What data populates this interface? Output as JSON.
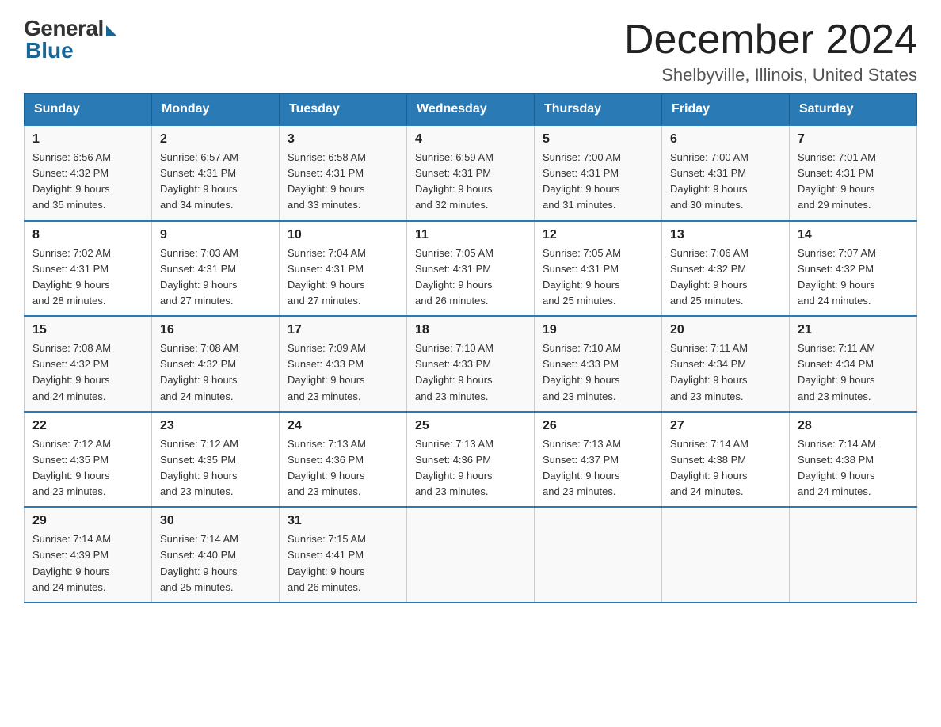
{
  "logo": {
    "general": "General",
    "blue": "Blue"
  },
  "title": {
    "month": "December 2024",
    "location": "Shelbyville, Illinois, United States"
  },
  "weekdays": [
    "Sunday",
    "Monday",
    "Tuesday",
    "Wednesday",
    "Thursday",
    "Friday",
    "Saturday"
  ],
  "weeks": [
    [
      {
        "day": "1",
        "sunrise": "6:56 AM",
        "sunset": "4:32 PM",
        "daylight": "9 hours and 35 minutes."
      },
      {
        "day": "2",
        "sunrise": "6:57 AM",
        "sunset": "4:31 PM",
        "daylight": "9 hours and 34 minutes."
      },
      {
        "day": "3",
        "sunrise": "6:58 AM",
        "sunset": "4:31 PM",
        "daylight": "9 hours and 33 minutes."
      },
      {
        "day": "4",
        "sunrise": "6:59 AM",
        "sunset": "4:31 PM",
        "daylight": "9 hours and 32 minutes."
      },
      {
        "day": "5",
        "sunrise": "7:00 AM",
        "sunset": "4:31 PM",
        "daylight": "9 hours and 31 minutes."
      },
      {
        "day": "6",
        "sunrise": "7:00 AM",
        "sunset": "4:31 PM",
        "daylight": "9 hours and 30 minutes."
      },
      {
        "day": "7",
        "sunrise": "7:01 AM",
        "sunset": "4:31 PM",
        "daylight": "9 hours and 29 minutes."
      }
    ],
    [
      {
        "day": "8",
        "sunrise": "7:02 AM",
        "sunset": "4:31 PM",
        "daylight": "9 hours and 28 minutes."
      },
      {
        "day": "9",
        "sunrise": "7:03 AM",
        "sunset": "4:31 PM",
        "daylight": "9 hours and 27 minutes."
      },
      {
        "day": "10",
        "sunrise": "7:04 AM",
        "sunset": "4:31 PM",
        "daylight": "9 hours and 27 minutes."
      },
      {
        "day": "11",
        "sunrise": "7:05 AM",
        "sunset": "4:31 PM",
        "daylight": "9 hours and 26 minutes."
      },
      {
        "day": "12",
        "sunrise": "7:05 AM",
        "sunset": "4:31 PM",
        "daylight": "9 hours and 25 minutes."
      },
      {
        "day": "13",
        "sunrise": "7:06 AM",
        "sunset": "4:32 PM",
        "daylight": "9 hours and 25 minutes."
      },
      {
        "day": "14",
        "sunrise": "7:07 AM",
        "sunset": "4:32 PM",
        "daylight": "9 hours and 24 minutes."
      }
    ],
    [
      {
        "day": "15",
        "sunrise": "7:08 AM",
        "sunset": "4:32 PM",
        "daylight": "9 hours and 24 minutes."
      },
      {
        "day": "16",
        "sunrise": "7:08 AM",
        "sunset": "4:32 PM",
        "daylight": "9 hours and 24 minutes."
      },
      {
        "day": "17",
        "sunrise": "7:09 AM",
        "sunset": "4:33 PM",
        "daylight": "9 hours and 23 minutes."
      },
      {
        "day": "18",
        "sunrise": "7:10 AM",
        "sunset": "4:33 PM",
        "daylight": "9 hours and 23 minutes."
      },
      {
        "day": "19",
        "sunrise": "7:10 AM",
        "sunset": "4:33 PM",
        "daylight": "9 hours and 23 minutes."
      },
      {
        "day": "20",
        "sunrise": "7:11 AM",
        "sunset": "4:34 PM",
        "daylight": "9 hours and 23 minutes."
      },
      {
        "day": "21",
        "sunrise": "7:11 AM",
        "sunset": "4:34 PM",
        "daylight": "9 hours and 23 minutes."
      }
    ],
    [
      {
        "day": "22",
        "sunrise": "7:12 AM",
        "sunset": "4:35 PM",
        "daylight": "9 hours and 23 minutes."
      },
      {
        "day": "23",
        "sunrise": "7:12 AM",
        "sunset": "4:35 PM",
        "daylight": "9 hours and 23 minutes."
      },
      {
        "day": "24",
        "sunrise": "7:13 AM",
        "sunset": "4:36 PM",
        "daylight": "9 hours and 23 minutes."
      },
      {
        "day": "25",
        "sunrise": "7:13 AM",
        "sunset": "4:36 PM",
        "daylight": "9 hours and 23 minutes."
      },
      {
        "day": "26",
        "sunrise": "7:13 AM",
        "sunset": "4:37 PM",
        "daylight": "9 hours and 23 minutes."
      },
      {
        "day": "27",
        "sunrise": "7:14 AM",
        "sunset": "4:38 PM",
        "daylight": "9 hours and 24 minutes."
      },
      {
        "day": "28",
        "sunrise": "7:14 AM",
        "sunset": "4:38 PM",
        "daylight": "9 hours and 24 minutes."
      }
    ],
    [
      {
        "day": "29",
        "sunrise": "7:14 AM",
        "sunset": "4:39 PM",
        "daylight": "9 hours and 24 minutes."
      },
      {
        "day": "30",
        "sunrise": "7:14 AM",
        "sunset": "4:40 PM",
        "daylight": "9 hours and 25 minutes."
      },
      {
        "day": "31",
        "sunrise": "7:15 AM",
        "sunset": "4:41 PM",
        "daylight": "9 hours and 26 minutes."
      },
      null,
      null,
      null,
      null
    ]
  ],
  "labels": {
    "sunrise": "Sunrise:",
    "sunset": "Sunset:",
    "daylight": "Daylight:"
  }
}
